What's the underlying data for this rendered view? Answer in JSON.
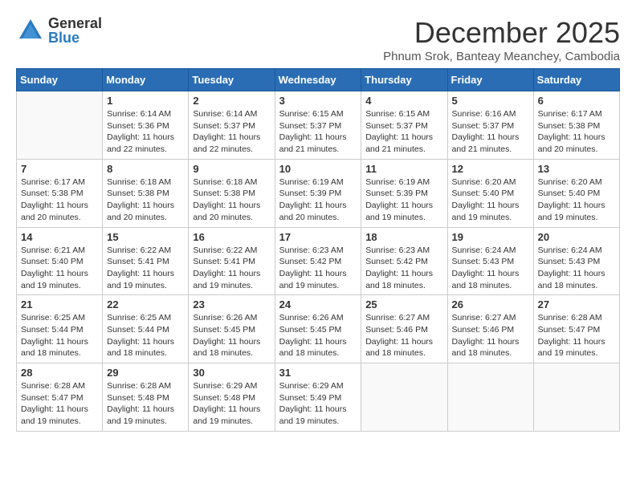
{
  "header": {
    "logo_general": "General",
    "logo_blue": "Blue",
    "month_title": "December 2025",
    "subtitle": "Phnum Srok, Banteay Meanchey, Cambodia"
  },
  "weekdays": [
    "Sunday",
    "Monday",
    "Tuesday",
    "Wednesday",
    "Thursday",
    "Friday",
    "Saturday"
  ],
  "weeks": [
    [
      {
        "day": "",
        "lines": []
      },
      {
        "day": "1",
        "lines": [
          "Sunrise: 6:14 AM",
          "Sunset: 5:36 PM",
          "Daylight: 11 hours",
          "and 22 minutes."
        ]
      },
      {
        "day": "2",
        "lines": [
          "Sunrise: 6:14 AM",
          "Sunset: 5:37 PM",
          "Daylight: 11 hours",
          "and 22 minutes."
        ]
      },
      {
        "day": "3",
        "lines": [
          "Sunrise: 6:15 AM",
          "Sunset: 5:37 PM",
          "Daylight: 11 hours",
          "and 21 minutes."
        ]
      },
      {
        "day": "4",
        "lines": [
          "Sunrise: 6:15 AM",
          "Sunset: 5:37 PM",
          "Daylight: 11 hours",
          "and 21 minutes."
        ]
      },
      {
        "day": "5",
        "lines": [
          "Sunrise: 6:16 AM",
          "Sunset: 5:37 PM",
          "Daylight: 11 hours",
          "and 21 minutes."
        ]
      },
      {
        "day": "6",
        "lines": [
          "Sunrise: 6:17 AM",
          "Sunset: 5:38 PM",
          "Daylight: 11 hours",
          "and 20 minutes."
        ]
      }
    ],
    [
      {
        "day": "7",
        "lines": [
          "Sunrise: 6:17 AM",
          "Sunset: 5:38 PM",
          "Daylight: 11 hours",
          "and 20 minutes."
        ]
      },
      {
        "day": "8",
        "lines": [
          "Sunrise: 6:18 AM",
          "Sunset: 5:38 PM",
          "Daylight: 11 hours",
          "and 20 minutes."
        ]
      },
      {
        "day": "9",
        "lines": [
          "Sunrise: 6:18 AM",
          "Sunset: 5:38 PM",
          "Daylight: 11 hours",
          "and 20 minutes."
        ]
      },
      {
        "day": "10",
        "lines": [
          "Sunrise: 6:19 AM",
          "Sunset: 5:39 PM",
          "Daylight: 11 hours",
          "and 20 minutes."
        ]
      },
      {
        "day": "11",
        "lines": [
          "Sunrise: 6:19 AM",
          "Sunset: 5:39 PM",
          "Daylight: 11 hours",
          "and 19 minutes."
        ]
      },
      {
        "day": "12",
        "lines": [
          "Sunrise: 6:20 AM",
          "Sunset: 5:40 PM",
          "Daylight: 11 hours",
          "and 19 minutes."
        ]
      },
      {
        "day": "13",
        "lines": [
          "Sunrise: 6:20 AM",
          "Sunset: 5:40 PM",
          "Daylight: 11 hours",
          "and 19 minutes."
        ]
      }
    ],
    [
      {
        "day": "14",
        "lines": [
          "Sunrise: 6:21 AM",
          "Sunset: 5:40 PM",
          "Daylight: 11 hours",
          "and 19 minutes."
        ]
      },
      {
        "day": "15",
        "lines": [
          "Sunrise: 6:22 AM",
          "Sunset: 5:41 PM",
          "Daylight: 11 hours",
          "and 19 minutes."
        ]
      },
      {
        "day": "16",
        "lines": [
          "Sunrise: 6:22 AM",
          "Sunset: 5:41 PM",
          "Daylight: 11 hours",
          "and 19 minutes."
        ]
      },
      {
        "day": "17",
        "lines": [
          "Sunrise: 6:23 AM",
          "Sunset: 5:42 PM",
          "Daylight: 11 hours",
          "and 19 minutes."
        ]
      },
      {
        "day": "18",
        "lines": [
          "Sunrise: 6:23 AM",
          "Sunset: 5:42 PM",
          "Daylight: 11 hours",
          "and 18 minutes."
        ]
      },
      {
        "day": "19",
        "lines": [
          "Sunrise: 6:24 AM",
          "Sunset: 5:43 PM",
          "Daylight: 11 hours",
          "and 18 minutes."
        ]
      },
      {
        "day": "20",
        "lines": [
          "Sunrise: 6:24 AM",
          "Sunset: 5:43 PM",
          "Daylight: 11 hours",
          "and 18 minutes."
        ]
      }
    ],
    [
      {
        "day": "21",
        "lines": [
          "Sunrise: 6:25 AM",
          "Sunset: 5:44 PM",
          "Daylight: 11 hours",
          "and 18 minutes."
        ]
      },
      {
        "day": "22",
        "lines": [
          "Sunrise: 6:25 AM",
          "Sunset: 5:44 PM",
          "Daylight: 11 hours",
          "and 18 minutes."
        ]
      },
      {
        "day": "23",
        "lines": [
          "Sunrise: 6:26 AM",
          "Sunset: 5:45 PM",
          "Daylight: 11 hours",
          "and 18 minutes."
        ]
      },
      {
        "day": "24",
        "lines": [
          "Sunrise: 6:26 AM",
          "Sunset: 5:45 PM",
          "Daylight: 11 hours",
          "and 18 minutes."
        ]
      },
      {
        "day": "25",
        "lines": [
          "Sunrise: 6:27 AM",
          "Sunset: 5:46 PM",
          "Daylight: 11 hours",
          "and 18 minutes."
        ]
      },
      {
        "day": "26",
        "lines": [
          "Sunrise: 6:27 AM",
          "Sunset: 5:46 PM",
          "Daylight: 11 hours",
          "and 18 minutes."
        ]
      },
      {
        "day": "27",
        "lines": [
          "Sunrise: 6:28 AM",
          "Sunset: 5:47 PM",
          "Daylight: 11 hours",
          "and 19 minutes."
        ]
      }
    ],
    [
      {
        "day": "28",
        "lines": [
          "Sunrise: 6:28 AM",
          "Sunset: 5:47 PM",
          "Daylight: 11 hours",
          "and 19 minutes."
        ]
      },
      {
        "day": "29",
        "lines": [
          "Sunrise: 6:28 AM",
          "Sunset: 5:48 PM",
          "Daylight: 11 hours",
          "and 19 minutes."
        ]
      },
      {
        "day": "30",
        "lines": [
          "Sunrise: 6:29 AM",
          "Sunset: 5:48 PM",
          "Daylight: 11 hours",
          "and 19 minutes."
        ]
      },
      {
        "day": "31",
        "lines": [
          "Sunrise: 6:29 AM",
          "Sunset: 5:49 PM",
          "Daylight: 11 hours",
          "and 19 minutes."
        ]
      },
      {
        "day": "",
        "lines": []
      },
      {
        "day": "",
        "lines": []
      },
      {
        "day": "",
        "lines": []
      }
    ]
  ],
  "accent_color": "#2a6db5"
}
